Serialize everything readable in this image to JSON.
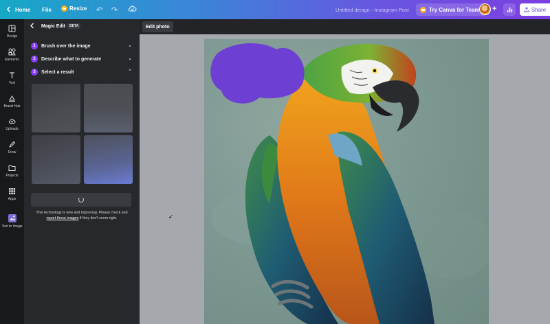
{
  "topbar": {
    "home": "Home",
    "file": "File",
    "resize": "Resize",
    "doc_title": "Untitled design - Instagram Post",
    "try_teams": "Try Canva for Teams",
    "share": "Share"
  },
  "rail": {
    "items": [
      {
        "label": "Design",
        "icon": "design-icon"
      },
      {
        "label": "Elements",
        "icon": "elements-icon"
      },
      {
        "label": "Text",
        "icon": "text-icon"
      },
      {
        "label": "Brand Hub",
        "icon": "brand-hub-icon"
      },
      {
        "label": "Uploads",
        "icon": "uploads-icon"
      },
      {
        "label": "Draw",
        "icon": "draw-icon"
      },
      {
        "label": "Projects",
        "icon": "projects-icon"
      },
      {
        "label": "Apps",
        "icon": "apps-icon"
      },
      {
        "label": "Text to Image",
        "icon": "text-to-image-icon"
      }
    ]
  },
  "panel": {
    "title": "Magic Edit",
    "badge": "BETA",
    "steps": [
      {
        "num": "1",
        "label": "Brush over the image"
      },
      {
        "num": "2",
        "label": "Describe what to generate"
      },
      {
        "num": "3",
        "label": "Select a result"
      }
    ],
    "note_before": "This technology is new and improving. Please check and ",
    "note_link": "report these images",
    "note_after": " if they don't seem right."
  },
  "canvas": {
    "edit_photo": "Edit photo"
  },
  "colors": {
    "accent": "#8b3dff",
    "brush": "#6b3ad6"
  }
}
